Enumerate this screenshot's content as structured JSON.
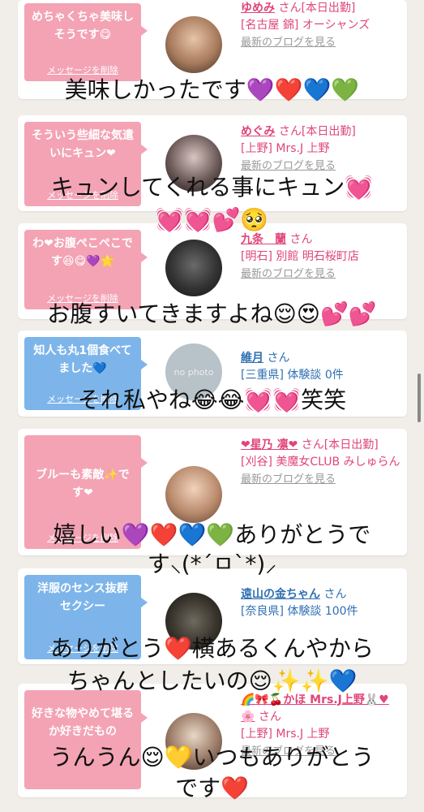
{
  "cards": [
    {
      "msg": "めちゃくちゃ美味しそうです😋",
      "delete": "メッセージを削除",
      "name": "ゆめみ",
      "san": "さん[本日出勤]",
      "shop": "[名古屋 錦] オーシャンズ",
      "blog": "最新のブログを見る"
    },
    {
      "msg": "そういう些細な気遣いにキュン❤",
      "delete": "メッセージを削除",
      "name": "めぐみ",
      "san": "さん[本日出勤]",
      "shop": "[上野] Mrs.J 上野",
      "blog": "最新のブログを見る"
    },
    {
      "msg": "わ❤お腹ぺこぺこです😆😋💜🌟",
      "delete": "メッセージを削除",
      "name": "九条　蘭",
      "san": "さん",
      "shop": "[明石] 別館 明石桜町店",
      "blog": "最新のブログを見る"
    },
    {
      "msg": "知人も丸1個食べてました💙",
      "delete": "メッセージを削除",
      "name": "維月",
      "san": "さん",
      "shop": "[三重県] 体験談 0件",
      "blog": "",
      "avatar_text": "no photo"
    },
    {
      "msg": "ブルーも素敵✨です❤",
      "delete": "メッセージを削除",
      "name": "❤星乃 凛❤",
      "san": "さん[本日出勤]",
      "shop": "[刈谷] 美魔女CLUB みしゅらん",
      "blog": "最新のブログを見る"
    },
    {
      "msg": "洋服のセンス抜群　セクシー",
      "delete": "メッセージを削除",
      "name": "遠山の金ちゃん",
      "san": "さん",
      "shop": "[奈良県] 体験談 100件",
      "blog": ""
    },
    {
      "msg": "好きな物やめて堪るか好きだもの",
      "delete": "",
      "name": "🌈🎀🍒かほ Mrs.J上野🐰♥🌸",
      "san": "さん",
      "shop": "[上野] Mrs.J 上野",
      "blog": "最新のブログを見る"
    }
  ],
  "overlays": [
    "美味しかったです💜❤️💙💚",
    "キュンしてくれる事にキュン💓",
    "💓💓💕🥺",
    "お腹すいてきますよね😌😍💕💕",
    "それ私やね😂😂💓💓笑笑",
    "嬉しい💜❤️💙💚ありがとうで",
    "す⸜(*´ㅁ`*)⸝",
    "ありがとう❤️横あるくんやから",
    "ちゃんとしたいの😌✨✨💙",
    "うんうん😌💛いつもありがとう",
    "です❤️"
  ],
  "colors": {
    "pink": "#f3a3b4",
    "blue": "#7db5ea",
    "accent": "#e0457a"
  }
}
